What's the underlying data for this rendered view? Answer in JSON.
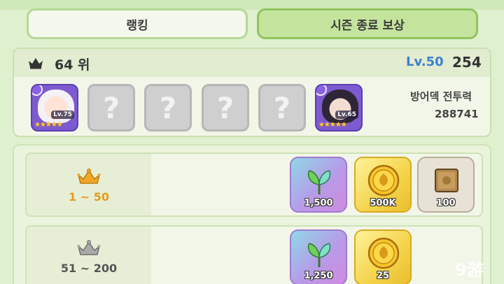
{
  "tabs": [
    {
      "label": "랭킹"
    },
    {
      "label": "시즌 종료 보상"
    }
  ],
  "my_rank": {
    "rank_text": "64 위",
    "level": "Lv.50",
    "score": "254",
    "power_label": "방어덱 전투력",
    "power_value": "288741",
    "heroes": [
      {
        "level": "Lv.75",
        "stars": "★★★★★"
      },
      {
        "level": "Lv.65",
        "stars": "★★★★★"
      }
    ],
    "empty_slot_glyph": "?"
  },
  "tiers": [
    {
      "range": "1 ~ 50",
      "crown_color": "#f0a726",
      "rewards": [
        {
          "icon": "crystal-leaf-icon",
          "qty": "1,500"
        },
        {
          "icon": "gold-coin-icon",
          "qty": "500K"
        },
        {
          "icon": "item-box-icon",
          "qty": "100"
        }
      ]
    },
    {
      "range": "51 ~ 200",
      "crown_color": "#a9a9a9",
      "rewards": [
        {
          "icon": "crystal-leaf-icon",
          "qty": "1,250"
        },
        {
          "icon": "gold-coin-icon",
          "qty": "25"
        }
      ]
    }
  ],
  "watermark": {
    "brand": "9游"
  },
  "colors": {
    "accent_green": "#8fc45c",
    "level_blue": "#3c7fd0"
  }
}
